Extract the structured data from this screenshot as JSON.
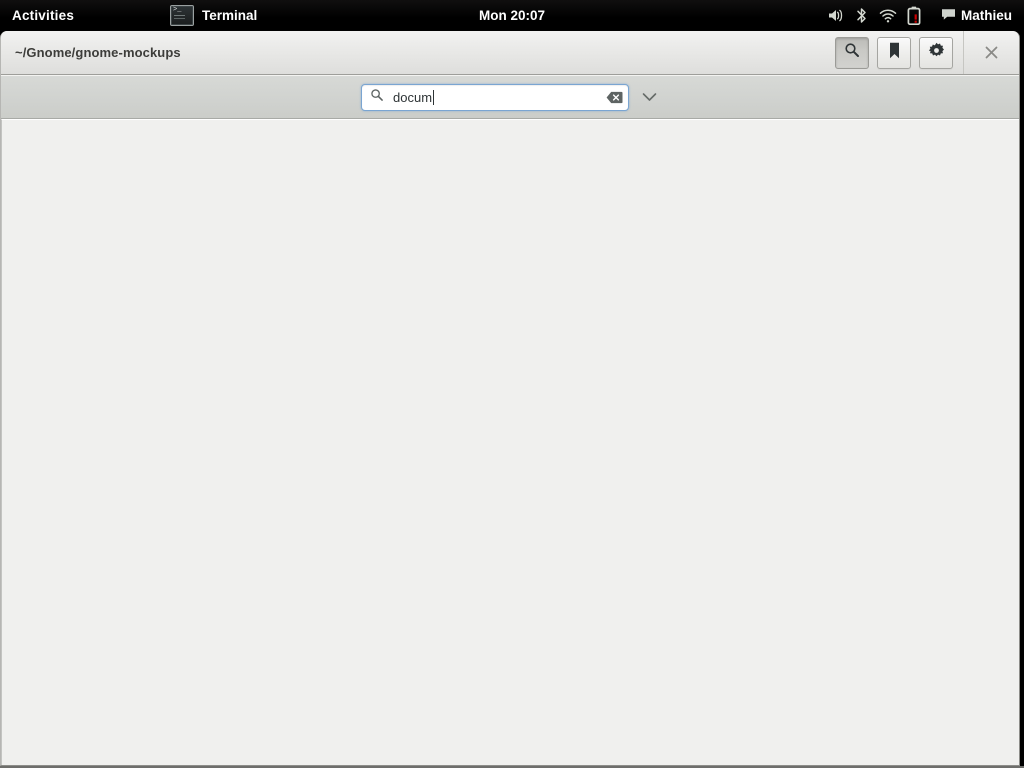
{
  "top_bar": {
    "activities_label": "Activities",
    "app_icon": "terminal-icon",
    "app_name": "Terminal",
    "clock": "Mon 20:07",
    "status_icons": [
      {
        "name": "volume-icon",
        "label": "Volume"
      },
      {
        "name": "bluetooth-icon",
        "label": "Bluetooth"
      },
      {
        "name": "wifi-icon",
        "label": "Wi-Fi"
      },
      {
        "name": "battery-caution-icon",
        "label": "Battery caution"
      }
    ],
    "user": {
      "icon": "chat-bubble-icon",
      "name": "Mathieu"
    }
  },
  "window": {
    "title": "~/Gnome/gnome-mockups",
    "header_buttons": [
      {
        "name": "search-button",
        "icon": "search-icon",
        "state": "active"
      },
      {
        "name": "bookmark-button",
        "icon": "bookmark-icon",
        "state": "normal"
      },
      {
        "name": "settings-button",
        "icon": "gear-icon",
        "state": "normal"
      }
    ],
    "close_label": "×"
  },
  "search_bar": {
    "icon": "search-icon",
    "value": "docum",
    "placeholder": "Search",
    "clear_icon": "clear-text-icon",
    "dropdown_icon": "chevron-down-icon"
  },
  "colors": {
    "top_bar_bg": "#000000",
    "header_bg": "#e8e8e6",
    "search_bar_bg": "#d0d2cf",
    "content_bg": "#f0f0ee",
    "focus_border": "#7aa5d2",
    "battery_warning": "#cc0000",
    "text": "#2e3436"
  }
}
